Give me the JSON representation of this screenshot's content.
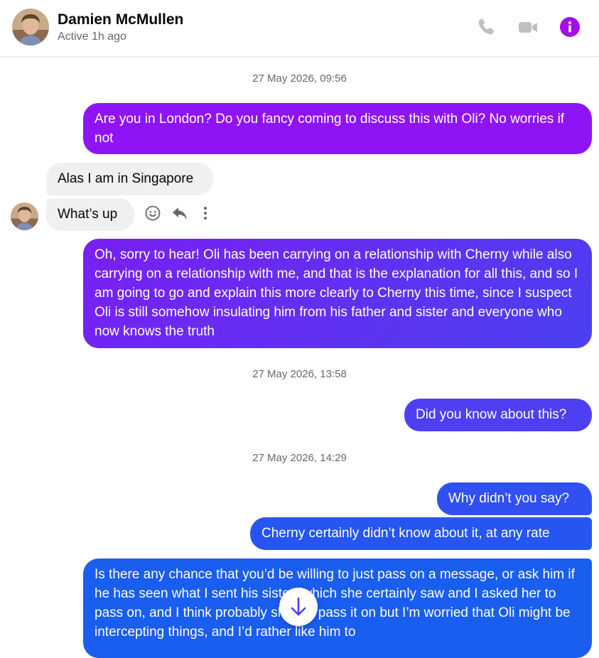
{
  "header": {
    "name": "Damien McMullen",
    "status": "Active 1h ago"
  },
  "icons": {
    "phone": "phone-icon",
    "video": "video-camera-icon",
    "info": "info-icon",
    "emoji": "smiley-icon",
    "reply": "reply-icon",
    "more": "more-vertical-icon",
    "scroll": "arrow-down-icon"
  },
  "colors": {
    "accent": "#a40ee8",
    "bubble_purple": "#8f14f5",
    "bubble_indigo": "#5a37f3",
    "bubble_blue": "#1a5ef0",
    "bubble_incoming": "#f0f0f0",
    "icon_grey": "#bcc0c4"
  },
  "thread": {
    "ts1": "27 May 2026, 09:56",
    "m1": "Are you in London? Do you fancy coming to discuss this with Oli? No worries if not",
    "m2": "Alas I am in Singapore",
    "m3": "What’s up",
    "m4": "Oh, sorry to hear! Oli has been carrying on a relationship with Cherny while also carrying on a relationship with me, and that is the explanation for all this, and so I am going to go and explain this more clearly to Cherny this time, since I suspect Oli is still somehow insulating him from his father and sister and everyone who now knows the truth",
    "ts2": "27 May 2026, 13:58",
    "m5": "Did you know about this?",
    "ts3": "27 May 2026, 14:29",
    "m6": "Why didn’t you say?",
    "m7": "Cherny certainly didn’t know about it, at any rate",
    "m8": "Is there any chance that you’d be willing to just pass on a message, or ask him if he has seen what I sent his sister (which she certainly saw and I asked her to pass on, and I think probably she did pass it on but I’m worried that Oli might be intercepting things, and I’d rather like him to"
  }
}
